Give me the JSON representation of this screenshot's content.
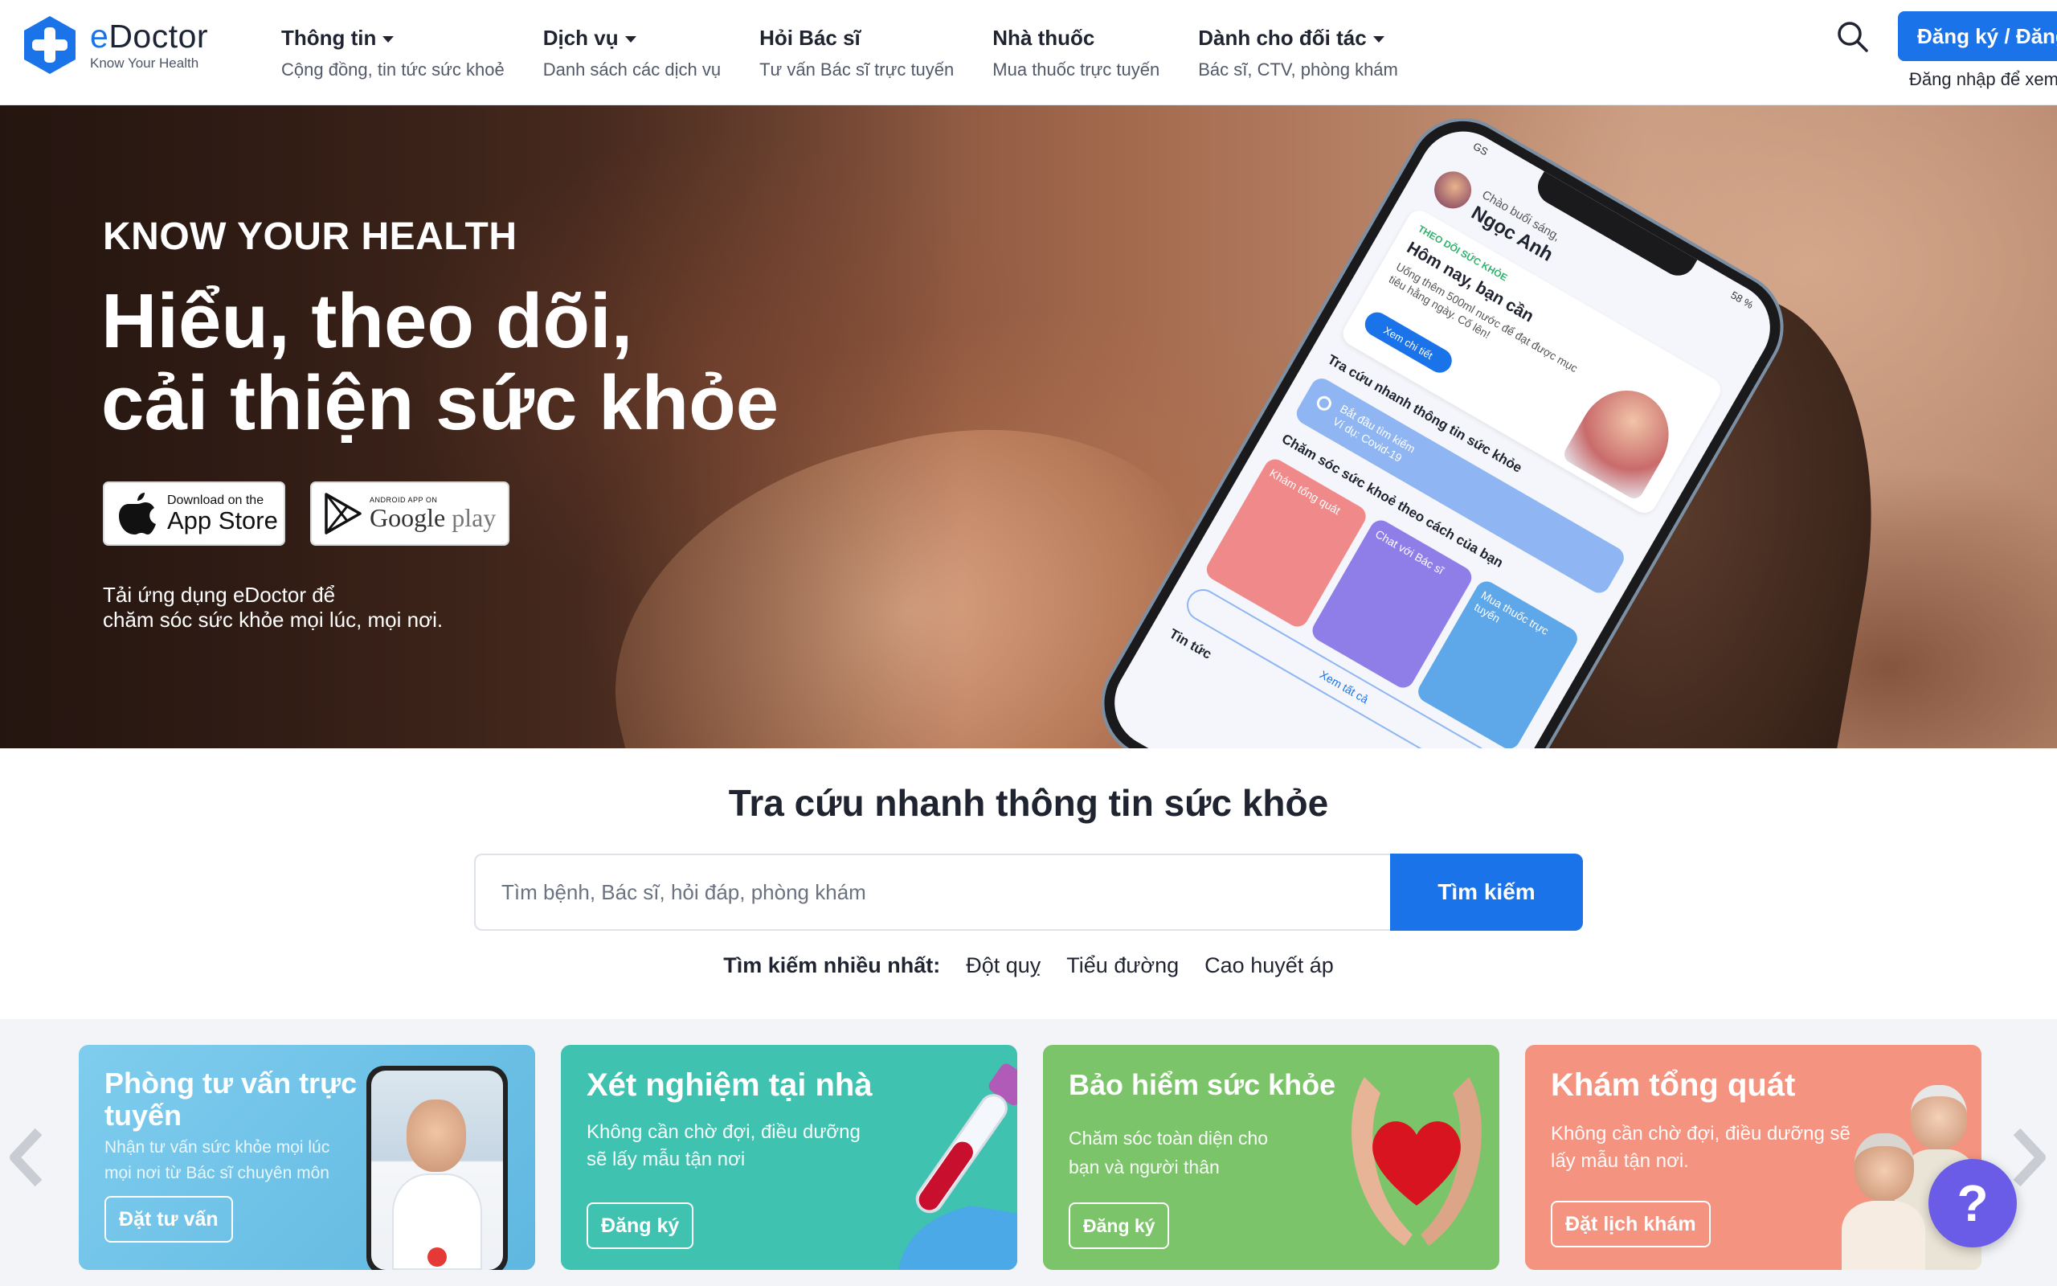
{
  "brand": {
    "name_e": "e",
    "name_rest": "Doctor",
    "tagline": "Know Your Health",
    "color": "#1a73e8"
  },
  "nav": [
    {
      "title": "Thông tin",
      "sub": "Cộng đồng, tin tức sức khoẻ",
      "dropdown": true
    },
    {
      "title": "Dịch vụ",
      "sub": "Danh sách các dịch vụ",
      "dropdown": true
    },
    {
      "title": "Hỏi Bác sĩ",
      "sub": "Tư vấn Bác sĩ trực tuyến",
      "dropdown": false
    },
    {
      "title": "Nhà thuốc",
      "sub": "Mua thuốc trực tuyến",
      "dropdown": false
    },
    {
      "title": "Dành cho đối tác",
      "sub": "Bác sĩ, CTV, phòng khám",
      "dropdown": true
    }
  ],
  "header": {
    "register_label": "Đăng ký / Đăng",
    "login_hint": "Đăng nhập để xem",
    "search_icon": "search-icon"
  },
  "hero": {
    "kicker": "KNOW YOUR HEALTH",
    "title_line1": "Hiểu, theo dõi,",
    "title_line2": "cải thiện sức khỏe",
    "app_store_small": "Download on the",
    "app_store_big": "App Store",
    "google_small": "ANDROID APP ON",
    "google_big_1": "Google",
    "google_big_2": " play",
    "desc_line1": "Tải ứng dụng eDoctor để",
    "desc_line2": "chăm sóc sức khỏe mọi lúc, mọi nơi."
  },
  "phone": {
    "status": "GS",
    "battery": "58 %",
    "greeting": "Chào buổi sáng,",
    "name": "Ngọc Anh",
    "card_tag": "THEO DÕI SỨC KHỎE",
    "card_title": "Hôm nay, bạn cần",
    "card_text": "Uống thêm 500ml nước để đạt được mục tiêu hằng ngày. Cố lên!",
    "card_button": "Xem chi tiết",
    "section_search": "Tra cứu nhanh thông tin sức khỏe",
    "search_placeholder": "Bắt đầu tìm kiếm",
    "search_example": "Ví dụ: Covid-19",
    "section_care": "Chăm sóc sức khoẻ theo cách của bạn",
    "tiles": [
      {
        "label": "Khám tổng quát",
        "color": "#f08a8a"
      },
      {
        "label": "Chat với Bác sĩ",
        "color": "#8f7ee8"
      },
      {
        "label": "Mua thuốc trực tuyến",
        "color": "#5ea7e8"
      }
    ],
    "see_all": "Xem tất cả",
    "news": "Tin tức"
  },
  "search": {
    "title": "Tra cứu nhanh thông tin sức khỏe",
    "placeholder": "Tìm bệnh, Bác sĩ, hỏi đáp, phòng khám",
    "button": "Tìm kiếm",
    "popular_label": "Tìm kiếm nhiều nhất:",
    "popular_tags": [
      "Đột quỵ",
      "Tiểu đường",
      "Cao huyết áp"
    ]
  },
  "cards": [
    {
      "title": "Phòng tư vấn trực tuyến",
      "desc": "Nhận tư vấn sức khỏe mọi lúc mọi nơi từ Bác sĩ chuyên môn",
      "button": "Đặt tư vấn",
      "color": "#6cc3e8"
    },
    {
      "title": "Xét nghiệm tại nhà",
      "desc": "Không cần chờ đợi, điều dưỡng sẽ lấy mẫu tận nơi",
      "button": "Đăng ký",
      "color": "#3fc3b0"
    },
    {
      "title": "Bảo hiểm sức khỏe",
      "desc": "Chăm sóc toàn diện cho bạn và người thân",
      "button": "Đăng ký",
      "color": "#7cc46a"
    },
    {
      "title": "Khám tổng quát",
      "desc": "Không cần chờ đợi, điều dưỡng sẽ lấy mẫu tận nơi.",
      "button": "Đặt lịch khám",
      "color": "#f49480"
    }
  ],
  "help": {
    "label": "?",
    "color": "#6b5ce7"
  }
}
